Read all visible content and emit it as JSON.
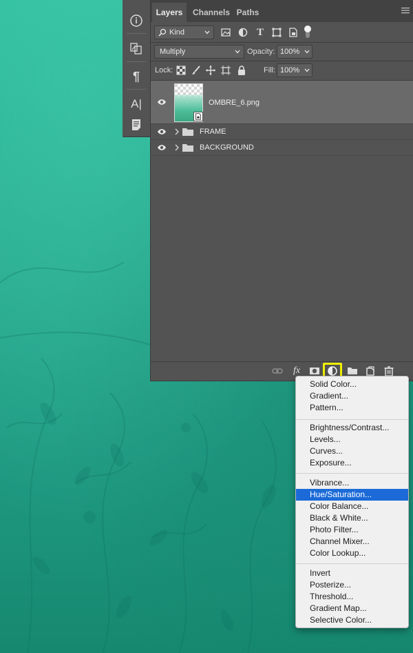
{
  "panel": {
    "tabs": [
      {
        "label": "Layers",
        "active": true
      },
      {
        "label": "Channels",
        "active": false
      },
      {
        "label": "Paths",
        "active": false
      }
    ],
    "filter_kind": "Kind",
    "blend_mode": "Multiply",
    "opacity_label": "Opacity:",
    "opacity_value": "100%",
    "lock_label": "Lock:",
    "fill_label": "Fill:",
    "fill_value": "100%"
  },
  "layers": [
    {
      "name": "OMBRE_6.png",
      "type": "smart-object",
      "visible": true,
      "selected": true
    },
    {
      "name": "FRAME",
      "type": "group",
      "visible": true,
      "selected": false
    },
    {
      "name": "BACKGROUND",
      "type": "group",
      "visible": true,
      "selected": false
    }
  ],
  "footer": {
    "icons": [
      "link-icon",
      "fx-icon",
      "mask-icon",
      "adjustment-icon",
      "group-folder-icon",
      "new-layer-icon",
      "trash-icon"
    ],
    "fx_label": "fx",
    "highlight_color": "#f0f000"
  },
  "adjustment_menu": {
    "groups": [
      [
        "Solid Color...",
        "Gradient...",
        "Pattern..."
      ],
      [
        "Brightness/Contrast...",
        "Levels...",
        "Curves...",
        "Exposure..."
      ],
      [
        "Vibrance...",
        "Hue/Saturation...",
        "Color Balance...",
        "Black & White...",
        "Photo Filter...",
        "Channel Mixer...",
        "Color Lookup..."
      ],
      [
        "Invert",
        "Posterize...",
        "Threshold...",
        "Gradient Map...",
        "Selective Color..."
      ]
    ],
    "highlighted": "Hue/Saturation...",
    "highlight_color": "#1b6ad8"
  },
  "tool_strip": {
    "icons": [
      "info-icon",
      "layer-comps-icon",
      "paragraph-icon",
      "character-icon",
      "notes-icon"
    ],
    "paragraph_glyph": "¶",
    "character_glyph": "A|"
  },
  "colors": {
    "panel_bg": "#535353",
    "tab_bar_bg": "#424242",
    "background_teal": "#27a98e"
  }
}
